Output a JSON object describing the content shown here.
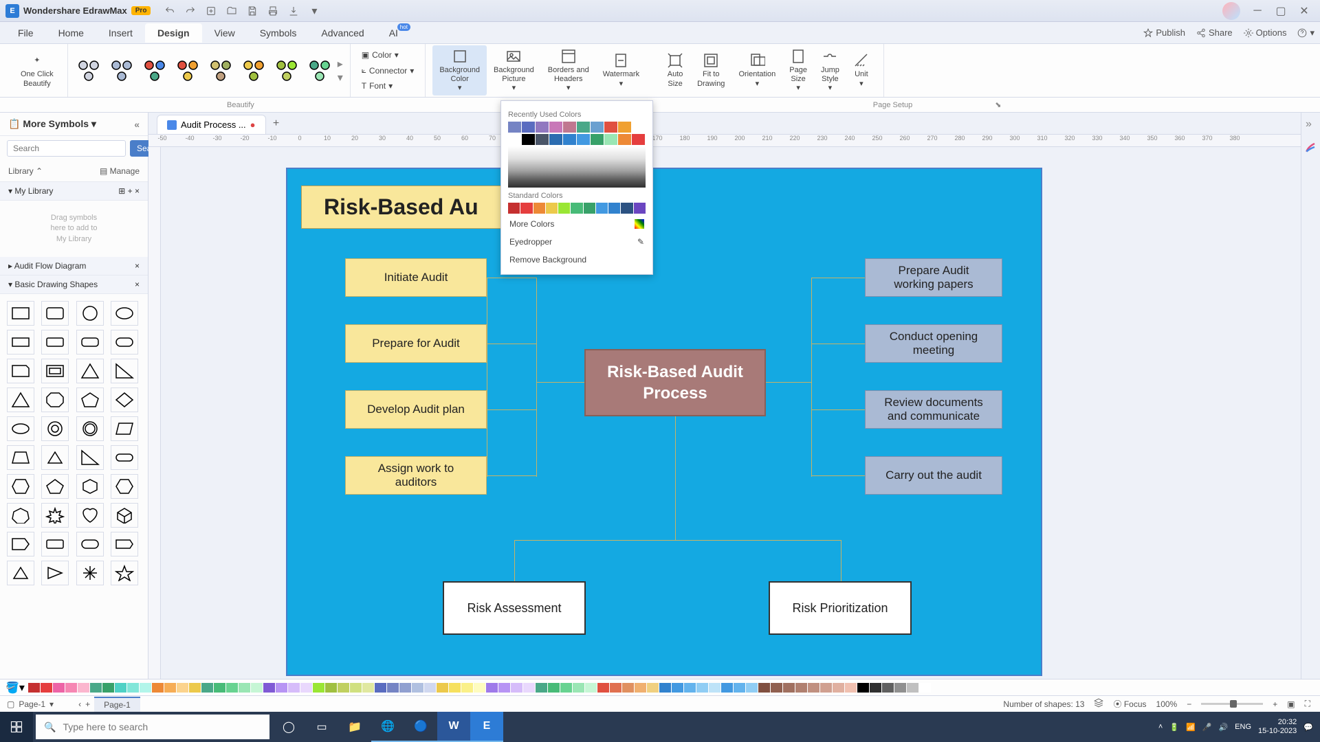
{
  "app": {
    "name": "Wondershare EdrawMax",
    "badge": "Pro"
  },
  "menus": {
    "file": "File",
    "home": "Home",
    "insert": "Insert",
    "design": "Design",
    "view": "View",
    "symbols": "Symbols",
    "advanced": "Advanced",
    "ai": "AI",
    "ai_hot": "hot"
  },
  "top_right": {
    "publish": "Publish",
    "share": "Share",
    "options": "Options"
  },
  "ribbon": {
    "oneclick": "One Click\nBeautify",
    "color": "Color",
    "connector": "Connector",
    "font": "Font",
    "bgcolor": "Background\nColor",
    "bgpic": "Background\nPicture",
    "borders": "Borders and\nHeaders",
    "watermark": "Watermark",
    "autosize": "Auto\nSize",
    "fit": "Fit to\nDrawing",
    "orientation": "Orientation",
    "pagesize": "Page\nSize",
    "jump": "Jump\nStyle",
    "unit": "Unit"
  },
  "ribbon_labels": {
    "beautify": "Beautify",
    "pagesetup": "Page Setup"
  },
  "left": {
    "header": "More Symbols",
    "search_placeholder": "Search",
    "search_btn": "Search",
    "library": "Library",
    "manage": "Manage",
    "mylib": "My Library",
    "drag_hint": "Drag symbols\nhere to add to\nMy Library",
    "audit": "Audit Flow Diagram",
    "basic": "Basic Drawing Shapes"
  },
  "tab": {
    "name": "Audit Process ..."
  },
  "ruler_h": [
    "-50",
    "-40",
    "-30",
    "-20",
    "-10",
    "0",
    "10",
    "20",
    "30",
    "40",
    "50",
    "60",
    "70",
    "",
    "",
    "140",
    "150",
    "160",
    "170",
    "180",
    "190",
    "200",
    "210",
    "220",
    "230",
    "240",
    "250",
    "260",
    "270",
    "280",
    "290",
    "300",
    "310",
    "320",
    "330",
    "340",
    "350",
    "360",
    "370",
    "380"
  ],
  "diagram": {
    "title": "Risk-Based Au",
    "left": [
      "Initiate Audit",
      "Prepare for Audit",
      "Develop Audit plan",
      "Assign work to auditors"
    ],
    "center": "Risk-Based Audit\nProcess",
    "right": [
      "Prepare Audit working papers",
      "Conduct opening meeting",
      "Review documents and communicate",
      "Carry out the audit"
    ],
    "bottom": [
      "Risk Assessment",
      "Risk Prioritization"
    ]
  },
  "picker": {
    "recent_label": "Recently Used Colors",
    "recent": [
      "#7584c4",
      "#5a6cc0",
      "#9178c0",
      "#c878b8",
      "#c07890",
      "#4aa888",
      "#6aa0d0",
      "#e05040",
      "#f0a030",
      "#ffffff"
    ],
    "grid_row1": [
      "#ffffff",
      "#000000",
      "#4a5568",
      "#2b6cb0",
      "#3182ce",
      "#4299e1",
      "#38a169",
      "#9ae6b4",
      "#ed8936",
      "#e53e3e"
    ],
    "std_label": "Standard Colors",
    "standard": [
      "#c53030",
      "#e53e3e",
      "#ed8936",
      "#ecc94b",
      "#9ae634",
      "#48bb78",
      "#38a169",
      "#4299e1",
      "#3182ce",
      "#2c5282",
      "#6b46c1"
    ],
    "more": "More Colors",
    "eyedropper": "Eyedropper",
    "remove": "Remove Background"
  },
  "color_strip": [
    "#c53030",
    "#e53e3e",
    "#ed64a6",
    "#f687b3",
    "#fbb6ce",
    "#4aa888",
    "#38a169",
    "#4fd1c5",
    "#81e6d9",
    "#b2f5ea",
    "#ed8936",
    "#f6ad55",
    "#fbd38d",
    "#ecc94b",
    "#4aa888",
    "#48bb78",
    "#68d391",
    "#9ae6b4",
    "#c6f6d5",
    "#805ad5",
    "#b794f4",
    "#d6bcfa",
    "#e9d8fd",
    "#9ae634",
    "#a0c040",
    "#c0d060",
    "#d0e080",
    "#e0e8a0",
    "#5a6cc0",
    "#7584c4",
    "#90a0d0",
    "#b0c0e0",
    "#d0d8f0",
    "#ecc94b",
    "#f6e05e",
    "#faf089",
    "#fefcbf",
    "#9f7aea",
    "#b794f4",
    "#d6bcfa",
    "#e9d8fd",
    "#4aa888",
    "#48bb78",
    "#68d391",
    "#9ae6b4",
    "#c6f6d5",
    "#e05040",
    "#e07050",
    "#e09060",
    "#f0b070",
    "#f0d080",
    "#3182ce",
    "#4299e1",
    "#63b3ed",
    "#90cdf4",
    "#bee3f8",
    "#4299e1",
    "#63b3ed",
    "#90cdf4",
    "#805040",
    "#906050",
    "#a07060",
    "#b08070",
    "#c09080",
    "#d0a090",
    "#e0b0a0",
    "#f0c0b0",
    "#000000",
    "#303030",
    "#606060",
    "#909090",
    "#c0c0c0",
    "#ffffff"
  ],
  "page": {
    "sel": "Page-1",
    "tab": "Page-1"
  },
  "status": {
    "shapes": "Number of shapes: 13",
    "focus": "Focus",
    "zoom": "100%",
    "lang": "ENG",
    "time": "20:32",
    "date": "15-10-2023"
  },
  "taskbar_search": "Type here to search"
}
